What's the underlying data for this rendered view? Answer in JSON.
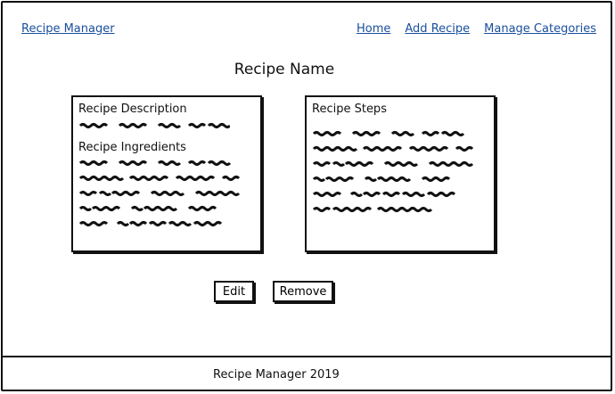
{
  "header": {
    "brand": "Recipe Manager",
    "nav": [
      "Home",
      "Add Recipe",
      "Manage Categories"
    ]
  },
  "page": {
    "title": "Recipe Name"
  },
  "panels": {
    "left": {
      "description_heading": "Recipe Description",
      "ingredients_heading": "Recipe Ingredients"
    },
    "right": {
      "steps_heading": "Recipe Steps"
    }
  },
  "actions": {
    "edit": "Edit",
    "remove": "Remove"
  },
  "footer": {
    "text": "Recipe Manager 2019"
  }
}
